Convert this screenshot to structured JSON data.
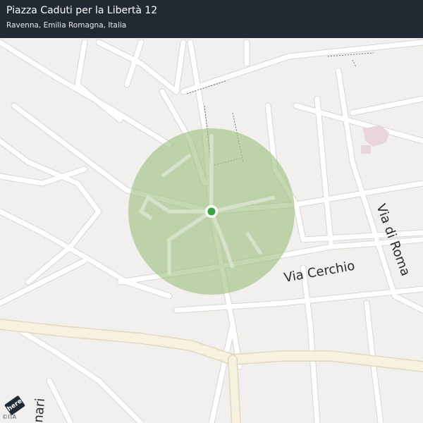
{
  "header": {
    "title": "Piazza Caduti per la Libertà 12",
    "subtitle": "Ravenna, Emilia Romagna, Italia"
  },
  "map": {
    "street_labels": {
      "via_cerchio": "Via Cerchio",
      "via_di_roma": "Via di Roma",
      "partial_bottom_left": "nari"
    },
    "colors": {
      "background": "#f1f0ee",
      "road_fill": "#ffffff",
      "road_casing": "#d6d4d0",
      "major_road": "#f7f1df",
      "accuracy_circle": "#9ec07f",
      "marker": "#3aa443",
      "header_background": "#212a33"
    },
    "marker": {
      "icon": "location-dot-icon"
    }
  },
  "footer": {
    "logo_text": "here",
    "attribution": "©ITA"
  }
}
